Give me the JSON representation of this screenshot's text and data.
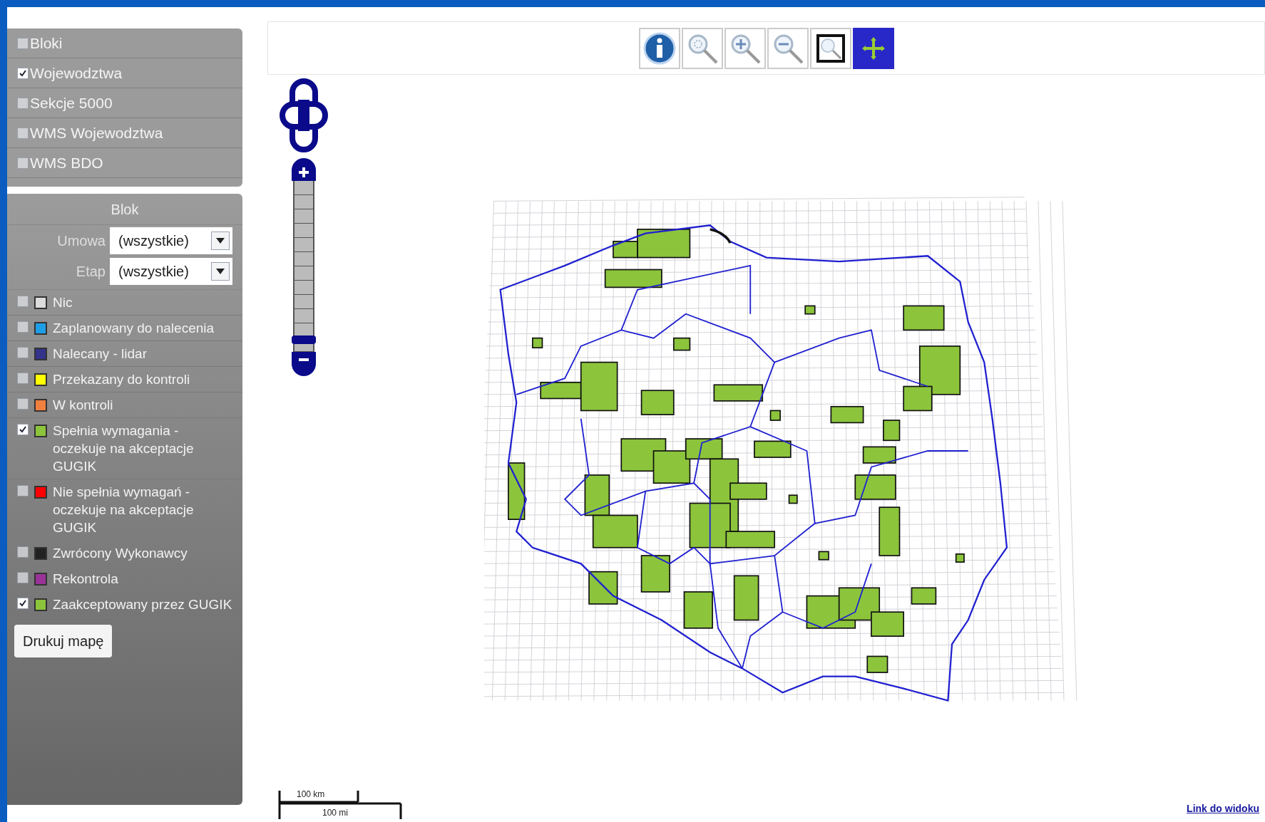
{
  "layers": [
    {
      "label": "Bloki",
      "checked": false
    },
    {
      "label": "Wojewodztwa",
      "checked": true
    },
    {
      "label": "Sekcje 5000",
      "checked": false
    },
    {
      "label": "WMS Wojewodztwa",
      "checked": false
    },
    {
      "label": "WMS BDO",
      "checked": false
    }
  ],
  "filter": {
    "title": "Blok",
    "fields": [
      {
        "label": "Umowa",
        "value": "(wszystkie)"
      },
      {
        "label": "Etap",
        "value": "(wszystkie)"
      }
    ]
  },
  "legend": [
    {
      "label": "Nic",
      "color": "#dcdcdc",
      "checked": false
    },
    {
      "label": "Zaplanowany do nalecenia",
      "color": "#1e9ee6",
      "checked": false
    },
    {
      "label": "Nalecany - lidar",
      "color": "#33338a",
      "checked": false
    },
    {
      "label": "Przekazany do kontroli",
      "color": "#ffff00",
      "checked": false
    },
    {
      "label": "W kontroli",
      "color": "#f08040",
      "checked": false
    },
    {
      "label": "Spełnia wymagania - oczekuje na akceptacje GUGIK",
      "color": "#8cc43c",
      "checked": true
    },
    {
      "label": "Nie spełnia wymagań - oczekuje na akceptacje GUGIK",
      "color": "#ff0000",
      "checked": false
    },
    {
      "label": "Zwrócony Wykonawcy",
      "color": "#222222",
      "checked": false
    },
    {
      "label": "Rekontrola",
      "color": "#993399",
      "checked": false
    },
    {
      "label": "Zaakceptowany przez GUGIK",
      "color": "#8cc43c",
      "checked": true
    }
  ],
  "print_button": "Drukuj mapę",
  "toolbar": [
    {
      "kind": "info",
      "selected": false
    },
    {
      "kind": "zoom-extent",
      "selected": false
    },
    {
      "kind": "zoom-in",
      "selected": false
    },
    {
      "kind": "zoom-out",
      "selected": false
    },
    {
      "kind": "zoom-box",
      "selected": false
    },
    {
      "kind": "pan",
      "selected": true
    }
  ],
  "zoom_slider": {
    "level": 0.05
  },
  "scale_bar": {
    "metric": "100 km",
    "imperial": "100 mi"
  },
  "link": "Link do widoku"
}
